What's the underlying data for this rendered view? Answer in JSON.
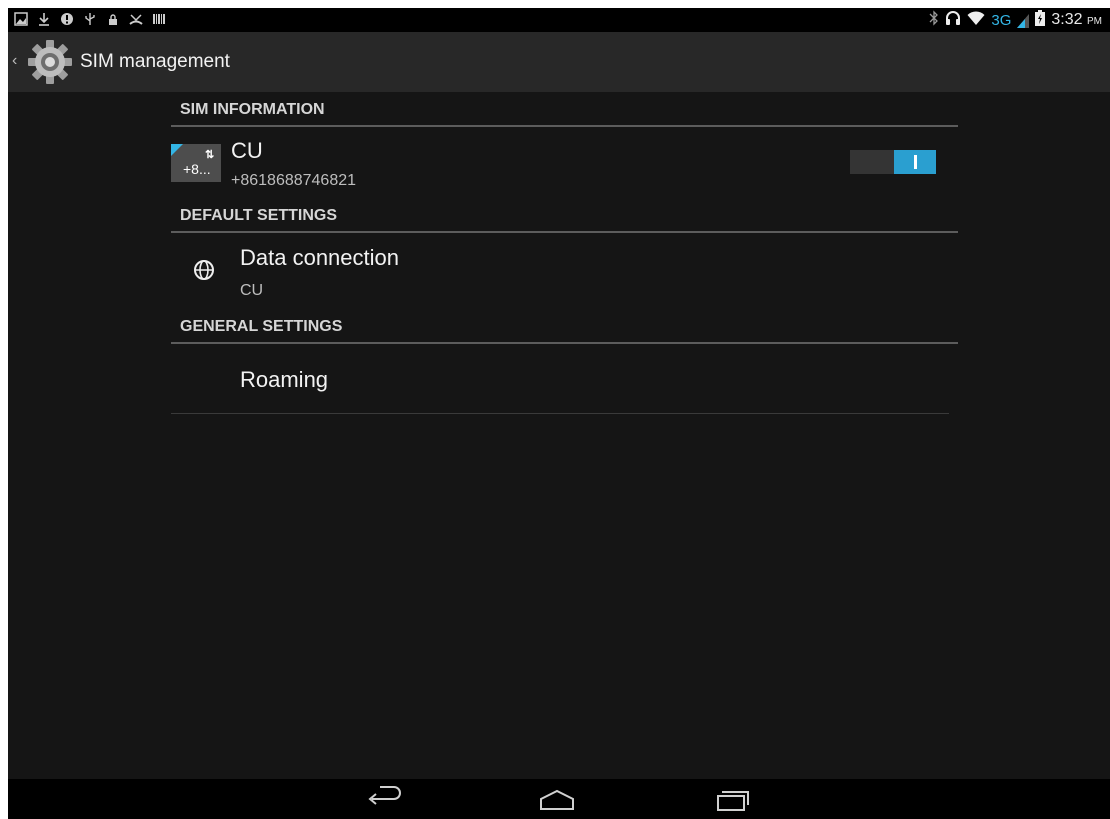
{
  "status_bar": {
    "left_icons": [
      "image-notification-icon",
      "download-icon",
      "alert-icon",
      "usb-icon",
      "lock-icon",
      "missed-call-icon",
      "barcode-icon"
    ],
    "right_icons": [
      "bluetooth-icon",
      "headset-icon",
      "wifi-icon",
      "signal-icon",
      "battery-icon"
    ],
    "network_type": "3G",
    "time": "3:32",
    "ampm": "PM"
  },
  "action_bar": {
    "title": "SIM management"
  },
  "sections": {
    "sim_information": {
      "header": "SIM INFORMATION"
    },
    "default_settings": {
      "header": "DEFAULT SETTINGS"
    },
    "general_settings": {
      "header": "GENERAL SETTINGS"
    }
  },
  "sim": {
    "badge_text": "+8...",
    "badge_arrows": "⇅",
    "name": "CU",
    "number": "+8618688746821",
    "enabled": true
  },
  "data_connection": {
    "title": "Data connection",
    "value": "CU"
  },
  "roaming": {
    "title": "Roaming"
  },
  "nav_bar": {
    "buttons": [
      "back-icon",
      "home-icon",
      "recents-icon"
    ]
  },
  "colors": {
    "accent": "#33b5e5",
    "background": "#151515",
    "action_bar": "#282828"
  }
}
